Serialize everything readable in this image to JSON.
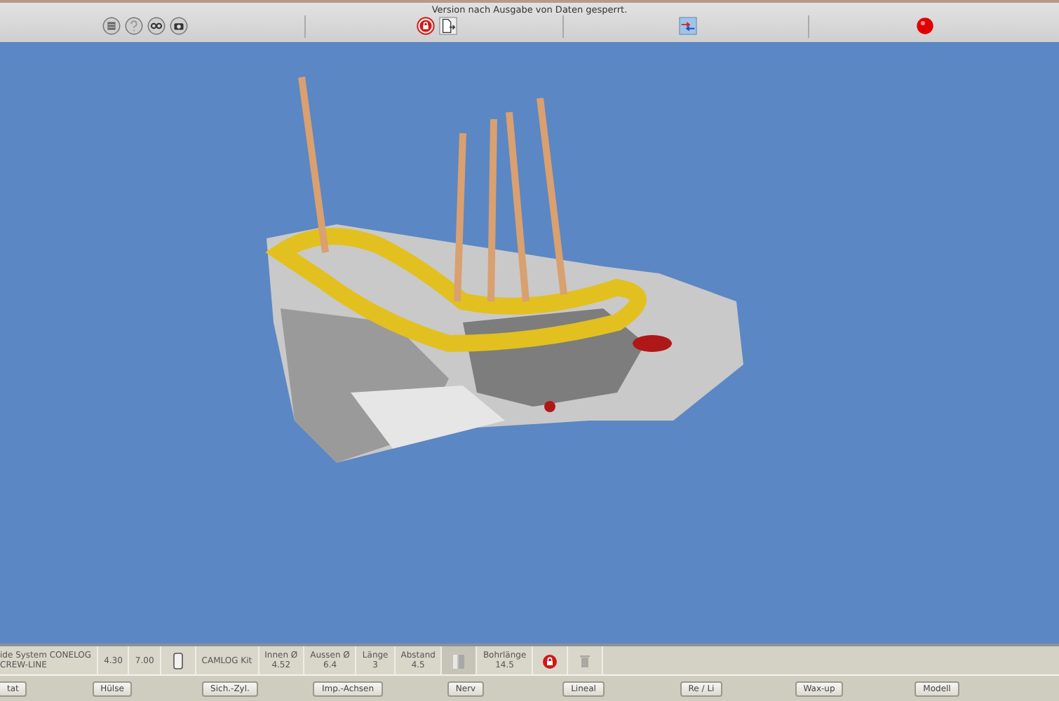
{
  "top_bar": {
    "notice": "Version nach Ausgabe von Daten gesperrt."
  },
  "info_bar": {
    "cells": [
      {
        "kind": "text",
        "lines": [
          "ide System CONELOG",
          "CREW-LINE"
        ]
      },
      {
        "kind": "text",
        "lines": [
          "4.30"
        ]
      },
      {
        "kind": "text",
        "lines": [
          "7.00"
        ]
      },
      {
        "kind": "cylinder"
      },
      {
        "kind": "text",
        "lines": [
          "CAMLOG Kit"
        ]
      },
      {
        "kind": "text",
        "lines": [
          "Innen Ø",
          "4.52"
        ]
      },
      {
        "kind": "text",
        "lines": [
          "Aussen Ø",
          "6.4"
        ]
      },
      {
        "kind": "text",
        "lines": [
          "Länge",
          "3"
        ]
      },
      {
        "kind": "text",
        "lines": [
          "Abstand",
          "4.5"
        ]
      },
      {
        "kind": "sleeve"
      },
      {
        "kind": "text",
        "lines": [
          "Bohrlänge",
          "14.5"
        ]
      },
      {
        "kind": "lock"
      },
      {
        "kind": "trash"
      }
    ]
  },
  "button_bar": {
    "buttons": [
      "tat",
      "Hülse",
      "Sich.-Zyl.",
      "Imp.-Achsen",
      "Nerv",
      "Lineal",
      "Re / Li",
      "Wax-up",
      "Modell"
    ]
  }
}
